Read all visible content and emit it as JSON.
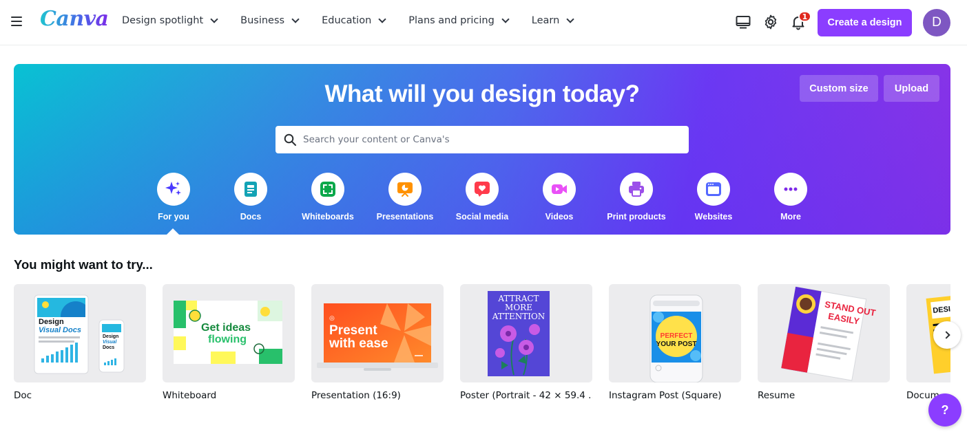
{
  "header": {
    "logo": "Canva",
    "nav": [
      {
        "label": "Design spotlight"
      },
      {
        "label": "Business"
      },
      {
        "label": "Education"
      },
      {
        "label": "Plans and pricing"
      },
      {
        "label": "Learn"
      }
    ],
    "notification_count": "1",
    "create_button": "Create a design",
    "avatar_initial": "D"
  },
  "hero": {
    "title": "What will you design today?",
    "custom_size": "Custom size",
    "upload": "Upload",
    "search_placeholder": "Search your content or Canva's",
    "categories": [
      {
        "label": "For you",
        "icon": "sparkle-icon",
        "color": "#4a3aff"
      },
      {
        "label": "Docs",
        "icon": "doc-icon",
        "color": "#13a3b5"
      },
      {
        "label": "Whiteboards",
        "icon": "whiteboard-icon",
        "color": "#0ba84a"
      },
      {
        "label": "Presentations",
        "icon": "presentation-icon",
        "color": "#ff9100"
      },
      {
        "label": "Social media",
        "icon": "heart-icon",
        "color": "#ff3b4b"
      },
      {
        "label": "Videos",
        "icon": "video-icon",
        "color": "#e950f7"
      },
      {
        "label": "Print products",
        "icon": "printer-icon",
        "color": "#9b4fe9"
      },
      {
        "label": "Websites",
        "icon": "website-icon",
        "color": "#5468ff"
      },
      {
        "label": "More",
        "icon": "more-icon",
        "color": "#7d2ae8"
      }
    ]
  },
  "suggestions": {
    "title": "You might want to try...",
    "cards": [
      {
        "label": "Doc"
      },
      {
        "label": "Whiteboard"
      },
      {
        "label": "Presentation (16:9)"
      },
      {
        "label": "Poster (Portrait - 42 × 59.4 ..."
      },
      {
        "label": "Instagram Post (Square)"
      },
      {
        "label": "Resume"
      },
      {
        "label": "Docum"
      }
    ],
    "thumb_text": {
      "doc_big": "Design",
      "doc_visual": "Visual Docs",
      "doc_small": "Design",
      "doc_small2": "Visual",
      "doc_small3": "Docs",
      "wb_line1": "Get ideas",
      "wb_line2": "flowing",
      "pres_line1": "Present",
      "pres_line2": "with ease",
      "poster_line1": "ATTRACT",
      "poster_line2": "MORE",
      "poster_line3": "ATTENTION",
      "ig_line1": "PERFECT",
      "ig_line2": "YOUR POST",
      "resume_line1": "STAND OUT",
      "resume_line2": "EASILY",
      "partial": "DESIG"
    }
  },
  "help": "?"
}
